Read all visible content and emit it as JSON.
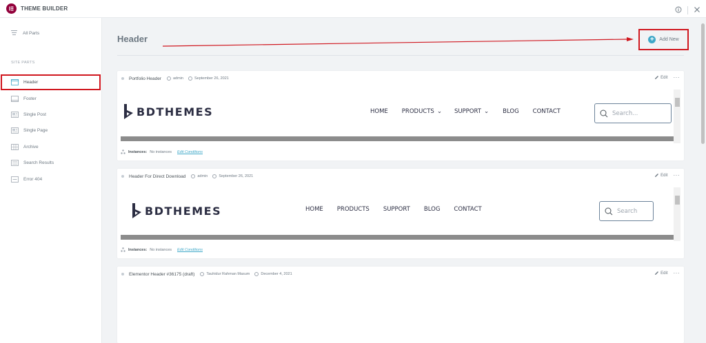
{
  "app": {
    "title": "THEME BUILDER"
  },
  "sidebar": {
    "all_parts": "All Parts",
    "section_label": "SITE PARTS",
    "items": [
      {
        "label": "Header",
        "icon": "header-icon"
      },
      {
        "label": "Footer",
        "icon": "footer-icon"
      },
      {
        "label": "Single Post",
        "icon": "single-post-icon"
      },
      {
        "label": "Single Page",
        "icon": "single-page-icon"
      },
      {
        "label": "Archive",
        "icon": "archive-icon"
      },
      {
        "label": "Search Results",
        "icon": "search-results-icon"
      },
      {
        "label": "Error 404",
        "icon": "error-404-icon"
      }
    ]
  },
  "main": {
    "title": "Header",
    "add_new": "Add New",
    "annotation_color": "#d0161e"
  },
  "cards": [
    {
      "title": "Portfolio Header",
      "author": "admin",
      "date": "September 26, 2021",
      "edit": "Edit",
      "instances_label": "Instances:",
      "instances_value": "No instances",
      "conditions_link": "Edit Conditions",
      "preview": {
        "brand": "BDTHEMES",
        "nav": [
          "HOME",
          "PRODUCTS",
          "SUPPORT",
          "BLOG",
          "CONTACT"
        ],
        "search_placeholder": "Search..."
      }
    },
    {
      "title": "Header For Direct Download",
      "author": "admin",
      "date": "September 26, 2021",
      "edit": "Edit",
      "instances_label": "Instances:",
      "instances_value": "No instances",
      "conditions_link": "Edit Conditions",
      "preview": {
        "brand": "BDTHEMES",
        "nav": [
          "HOME",
          "PRODUCTS",
          "SUPPORT",
          "BLOG",
          "CONTACT"
        ],
        "search_placeholder": "Search"
      }
    },
    {
      "title": "Elementor Header #36175 (draft)",
      "author": "Tauhidur Rahman Masum",
      "date": "December 4, 2021",
      "edit": "Edit"
    }
  ],
  "colors": {
    "accent": "#92003b",
    "add_new": "#3fa8c8",
    "link": "#3fa8c8"
  }
}
